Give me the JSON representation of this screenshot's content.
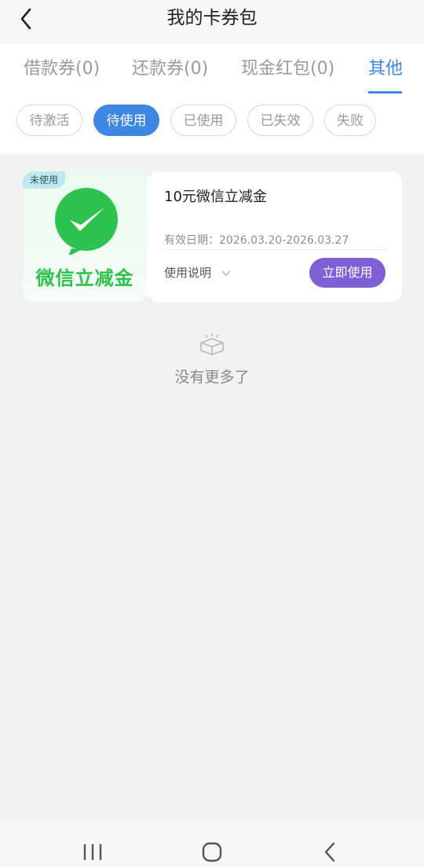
{
  "header": {
    "title": "我的卡券包"
  },
  "tabs": [
    {
      "label": "借款券(0)"
    },
    {
      "label": "还款券(0)"
    },
    {
      "label": "现金红包(0)"
    },
    {
      "label": "其他"
    }
  ],
  "filters": [
    {
      "label": "待激活"
    },
    {
      "label": "待使用"
    },
    {
      "label": "已使用"
    },
    {
      "label": "已失效"
    },
    {
      "label": "失败"
    }
  ],
  "coupon": {
    "badge": "未使用",
    "brand_text": "微信立减金",
    "name": "10元微信立减金",
    "validity": "有效日期：2026.03.20-2026.03.27",
    "usage_link": "使用说明",
    "use_button": "立即使用"
  },
  "empty_text": "没有更多了",
  "colors": {
    "accent": "#3d86e4",
    "button": "#7e5fd6",
    "wechat_green": "#2cc24d"
  }
}
